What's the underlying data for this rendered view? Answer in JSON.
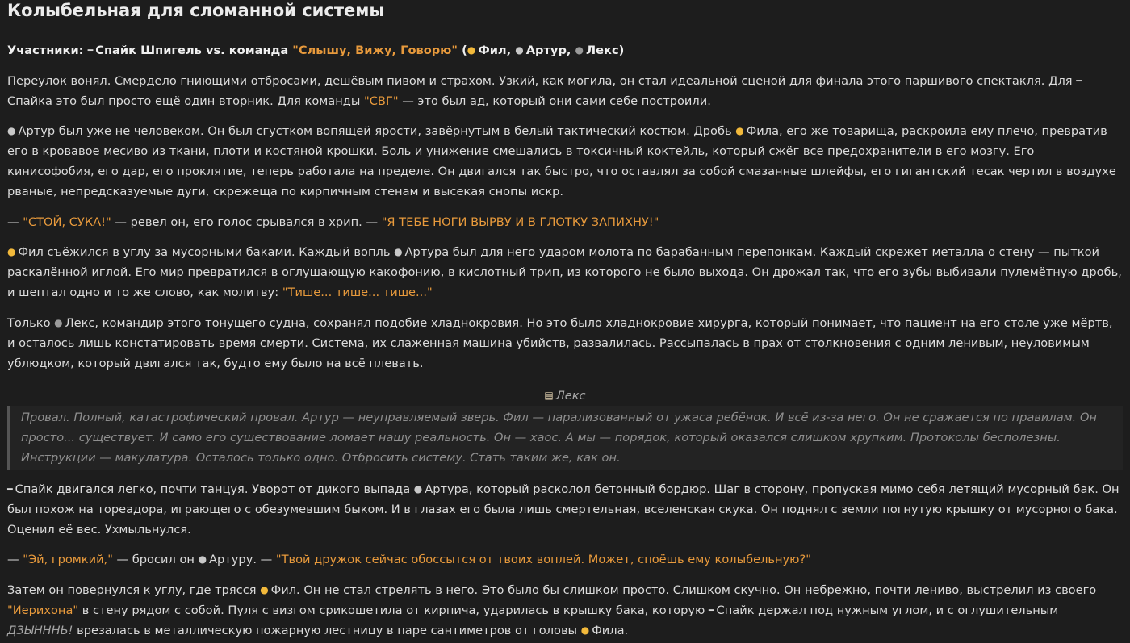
{
  "title": "Колыбельная для сломанной системы",
  "participants": {
    "label": "Участники:",
    "spike": "Спайк Шпигель vs. команда",
    "team": "\"Слышу, Вижу, Говорю\"",
    "open": "(",
    "phil": "Фил,",
    "artur": "Артур,",
    "lex": "Лекс)"
  },
  "p1": {
    "a": "Переулок вонял. Смердело гниющими отбросами, дешёвым пивом и страхом. Узкий, как могила, он стал идеальной сценой для финала этого паршивого спектакля. Для",
    "b": "Спайка это был просто ещё один вторник. Для команды",
    "svg": "\"СВГ\"",
    "c": "— это был ад, который они сами себе построили."
  },
  "p2": {
    "a": "Артур был уже не человеком. Он был сгустком вопящей ярости, завёрнутым в белый тактический костюм. Дробь",
    "b": "Фила, его же товарища, раскроила ему плечо, превратив его в кровавое месиво из ткани, плоти и костяной крошки. Боль и унижение смешались в токсичный коктейль, который сжёг все предохранители в его мозгу. Его кинисофобия, его дар, его проклятие, теперь работала на пределе. Он двигался так быстро, что оставлял за собой смазанные шлейфы, его гигантский тесак чертил в воздухе рваные, непредсказуемые дуги, скрежеща по кирпичным стенам и высекая снопы искр."
  },
  "p3": {
    "a": "—",
    "q1": "\"СТОЙ, СУКА!\"",
    "b": "— ревел он, его голос срывался в хрип. —",
    "q2": "\"Я ТЕБЕ НОГИ ВЫРВУ И В ГЛОТКУ ЗАПИХНУ!\""
  },
  "p4": {
    "a": "Фил съёжился в углу за мусорными баками. Каждый вопль",
    "b": "Артура был для него ударом молота по барабанным перепонкам. Каждый скрежет металла о стену — пыткой раскалённой иглой. Его мир превратился в оглушающую какофонию, в кислотный трип, из которого не было выхода. Он дрожал так, что его зубы выбивали пулемётную дробь, и шептал одно и то же слово, как молитву:",
    "q": "\"Тише... тише... тише...\""
  },
  "p5": {
    "a": "Только",
    "b": "Лекс, командир этого тонущего судна, сохранял подобие хладнокровия. Но это было хладнокровие хирурга, который понимает, что пациент на его столе уже мёртв, и осталось лишь констатировать время смерти. Система, их слаженная машина убийств, развалилась. Рассыпалась в прах от столкновения с одним ленивым, неуловимым ублюдком, который двигался так, будто ему было на всё плевать."
  },
  "speaker": "Лекс",
  "quote": "Провал. Полный, катастрофический провал. Артур — неуправляемый зверь. Фил — парализованный от ужаса ребёнок. И всё из-за него. Он не сражается по правилам. Он просто... существует. И само его существование ломает нашу реальность. Он — хаос. А мы — порядок, который оказался слишком хрупким. Протоколы бесполезны. Инструкции — макулатура. Осталось только одно. Отбросить систему. Стать таким же, как он.",
  "p6": {
    "a": "Спайк двигался легко, почти танцуя. Уворот от дикого выпада",
    "b": "Артура, который расколол бетонный бордюр. Шаг в сторону, пропуская мимо себя летящий мусорный бак. Он был похож на тореадора, играющего с обезумевшим быком. И в глазах его была лишь смертельная, вселенская скука. Он поднял с земли погнутую крышку от мусорного бака. Оценил её вес. Ухмыльнулся."
  },
  "p7": {
    "a": "—",
    "q1": "\"Эй, громкий,\"",
    "b": "— бросил он",
    "c": "Артуру. —",
    "q2": "\"Твой дружок сейчас обоссытся от твоих воплей. Может, споёшь ему колыбельную?\""
  },
  "p8": {
    "a": "Затем он повернулся к углу, где трясся",
    "b": "Фил. Он не стал стрелять в него. Это было бы слишком просто. Слишком скучно. Он небрежно, почти лениво, выстрелил из своего",
    "jericho": "\"Иерихона\"",
    "c": "в стену рядом с собой. Пуля с визгом срикошетила от кирпича, ударилась в крышку бака, которую",
    "d": "Спайк держал под нужным углом, и с оглушительным",
    "sfx": "ДЗЫНННЬ!",
    "e": "врезалась в металлическую пожарную лестницу в паре сантиметров от головы",
    "f": "Фила."
  },
  "icons": {
    "spike": "cigarette-icon",
    "phil": "earring-icon",
    "artur": "bomb-icon",
    "lex": "bust-icon",
    "speaker": "scroll-icon"
  },
  "colors": {
    "accent": "#e89a3c",
    "background": "#1d1d1d",
    "text": "#dcdcdc"
  }
}
